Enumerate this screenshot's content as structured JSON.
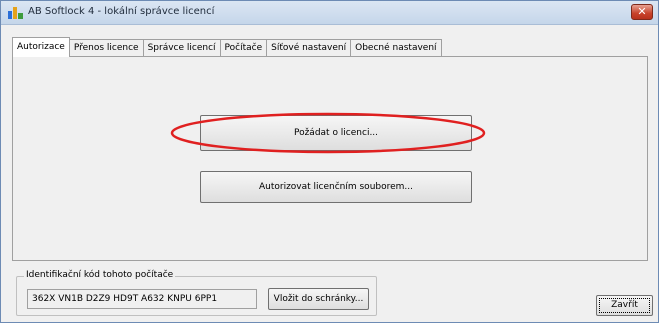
{
  "window": {
    "title": "AB Softlock 4  -  lokální správce licencí",
    "close_glyph": "✕"
  },
  "tabs": [
    {
      "label": "Autorizace",
      "active": true
    },
    {
      "label": "Přenos licence",
      "active": false
    },
    {
      "label": "Správce licencí",
      "active": false
    },
    {
      "label": "Počítače",
      "active": false
    },
    {
      "label": "Síťové nastavení",
      "active": false
    },
    {
      "label": "Obecné nastavení",
      "active": false
    }
  ],
  "authorization": {
    "request_license_label": "Požádat o licenci...",
    "authorize_by_file_label": "Autorizovat licenčním souborem..."
  },
  "machine_id": {
    "group_label": "Identifikační kód tohoto počítače",
    "code": "362X VN1B D2Z9 HD9T A632 KNPU 6PP1",
    "copy_label": "Vložit do schránky..."
  },
  "footer": {
    "close_label": "Zavřít"
  },
  "colors": {
    "highlight": "#e02020"
  },
  "icons": [
    "app-icon",
    "close-icon"
  ]
}
